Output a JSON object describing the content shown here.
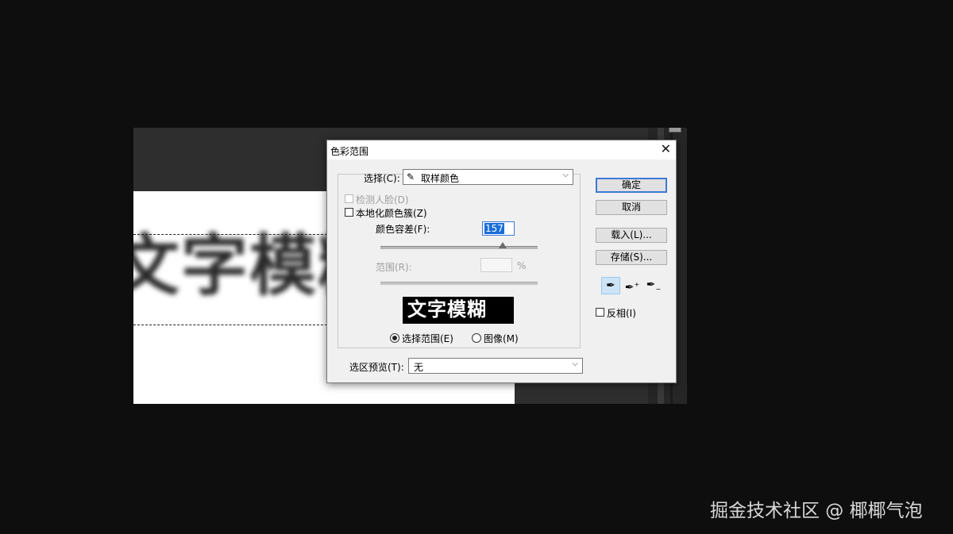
{
  "canvas": {
    "text": "文字模糊"
  },
  "dialog": {
    "title": "色彩范围",
    "close": "✕",
    "select_label": "选择(C):",
    "select_value": "取样颜色",
    "detect_faces": "检测人脸(D)",
    "localized_clusters": "本地化颜色簇(Z)",
    "fuzziness_label": "颜色容差(F):",
    "fuzziness_value": "157",
    "fuzziness_fraction": 0.78,
    "range_label": "范围(R):",
    "range_unit": "%",
    "preview_text": "文字模糊",
    "radio_selection": "选择范围(E)",
    "radio_image": "图像(M)",
    "selection_preview_label": "选区预览(T):",
    "selection_preview_value": "无",
    "buttons": {
      "ok": "确定",
      "cancel": "取消",
      "load": "载入(L)...",
      "save": "存储(S)..."
    },
    "invert": "反相(I)",
    "icons": [
      "eyedropper-icon",
      "eyedropper-plus-icon",
      "eyedropper-minus-icon"
    ]
  },
  "watermark": "掘金技术社区 @ 椰椰气泡"
}
